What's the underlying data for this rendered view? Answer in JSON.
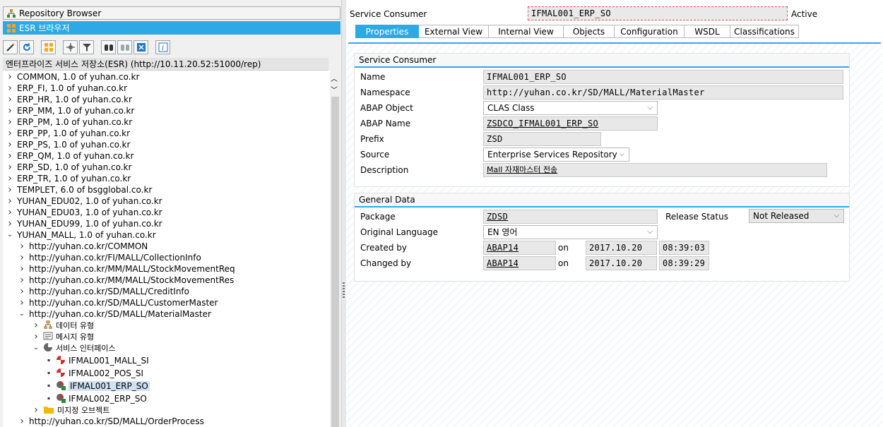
{
  "nav": {
    "repository_browser": "Repository Browser",
    "esr_browser": "ESR 브라우저"
  },
  "toolbar_icons": [
    "wand-icon",
    "refresh-icon",
    "hierarchy-icon",
    "settings-icon",
    "filter-icon",
    "binoculars-icon",
    "binoculars-next-icon",
    "delete-icon",
    "info-icon"
  ],
  "path_label": "엔터프라이즈 서비스 저장소(ESR) (http://10.11.20.52:51000/rep)",
  "tree": [
    {
      "label": "COMMON, 1.0 of yuhan.co.kr",
      "level": 0,
      "chevron": ">",
      "icon": ""
    },
    {
      "label": "ERP_FI, 1.0 of yuhan.co.kr",
      "level": 0,
      "chevron": ">",
      "icon": ""
    },
    {
      "label": "ERP_HR, 1.0 of yuhan.co.kr",
      "level": 0,
      "chevron": ">",
      "icon": ""
    },
    {
      "label": "ERP_MM, 1.0 of yuhan.co.kr",
      "level": 0,
      "chevron": ">",
      "icon": ""
    },
    {
      "label": "ERP_PM, 1.0 of yuhan.co.kr",
      "level": 0,
      "chevron": ">",
      "icon": ""
    },
    {
      "label": "ERP_PP, 1.0 of yuhan.co.kr",
      "level": 0,
      "chevron": ">",
      "icon": ""
    },
    {
      "label": "ERP_PS, 1.0 of yuhan.co.kr",
      "level": 0,
      "chevron": ">",
      "icon": ""
    },
    {
      "label": "ERP_QM, 1.0 of yuhan.co.kr",
      "level": 0,
      "chevron": ">",
      "icon": ""
    },
    {
      "label": "ERP_SD, 1.0 of yuhan.co.kr",
      "level": 0,
      "chevron": ">",
      "icon": ""
    },
    {
      "label": "ERP_TR, 1.0 of yuhan.co.kr",
      "level": 0,
      "chevron": ">",
      "icon": ""
    },
    {
      "label": "TEMPLET, 6.0 of bsgglobal.co.kr",
      "level": 0,
      "chevron": ">",
      "icon": ""
    },
    {
      "label": "YUHAN_EDU02, 1.0 of yuhan.co.kr",
      "level": 0,
      "chevron": ">",
      "icon": ""
    },
    {
      "label": "YUHAN_EDU03, 1.0 of yuhan.co.kr",
      "level": 0,
      "chevron": ">",
      "icon": ""
    },
    {
      "label": "YUHAN_EDU99, 1.0 of yuhan.co.kr",
      "level": 0,
      "chevron": ">",
      "icon": ""
    },
    {
      "label": "YUHAN_MALL, 1.0 of yuhan.co.kr",
      "level": 0,
      "chevron": "v",
      "icon": ""
    },
    {
      "label": "http://yuhan.co.kr/COMMON",
      "level": 1,
      "chevron": ">",
      "icon": ""
    },
    {
      "label": "http://yuhan.co.kr/FI/MALL/CollectionInfo",
      "level": 1,
      "chevron": ">",
      "icon": ""
    },
    {
      "label": "http://yuhan.co.kr/MM/MALL/StockMovementReq",
      "level": 1,
      "chevron": ">",
      "icon": ""
    },
    {
      "label": "http://yuhan.co.kr/MM/MALL/StockMovementRes",
      "level": 1,
      "chevron": ">",
      "icon": ""
    },
    {
      "label": "http://yuhan.co.kr/SD/MALL/CreditInfo",
      "level": 1,
      "chevron": ">",
      "icon": ""
    },
    {
      "label": "http://yuhan.co.kr/SD/MALL/CustomerMaster",
      "level": 1,
      "chevron": ">",
      "icon": ""
    },
    {
      "label": "http://yuhan.co.kr/SD/MALL/MaterialMaster",
      "level": 1,
      "chevron": "v",
      "icon": ""
    },
    {
      "label": "데이터 유형",
      "level": 2,
      "chevron": ">",
      "icon": "datatype-icon"
    },
    {
      "label": "메시지 유형",
      "level": 2,
      "chevron": ">",
      "icon": "message-type-icon"
    },
    {
      "label": "서비스 인터페이스",
      "level": 2,
      "chevron": "v",
      "icon": "service-interface-icon"
    },
    {
      "label": "IFMAL001_MALL_SI",
      "level": 3,
      "chevron": "•",
      "icon": "interface-icon"
    },
    {
      "label": "IFMAL002_POS_SI",
      "level": 3,
      "chevron": "•",
      "icon": "interface-icon"
    },
    {
      "label": "IFMAL001_ERP_SO",
      "level": 3,
      "chevron": "•",
      "icon": "consumer-icon",
      "selected": true
    },
    {
      "label": "IFMAL002_ERP_SO",
      "level": 3,
      "chevron": "•",
      "icon": "consumer-icon"
    },
    {
      "label": "미지정 오브젝트",
      "level": 2,
      "chevron": ">",
      "icon": "folder-icon"
    },
    {
      "label": "http://yuhan.co.kr/SD/MALL/OrderProcess",
      "level": 1,
      "chevron": ">",
      "icon": ""
    }
  ],
  "header": {
    "object_type": "Service Consumer",
    "object_name": "IFMAL001_ERP_SO",
    "status": "Active"
  },
  "tabs": [
    "Properties",
    "External View",
    "Internal View",
    "Objects",
    "Configuration",
    "WSDL",
    "Classifications"
  ],
  "active_tab": "Properties",
  "service_consumer_group": {
    "title": "Service Consumer",
    "name_label": "Name",
    "name_value": "IFMAL001_ERP_SO",
    "namespace_label": "Namespace",
    "namespace_value": "http://yuhan.co.kr/SD/MALL/MaterialMaster",
    "abap_object_label": "ABAP Object",
    "abap_object_value": "CLAS Class",
    "abap_name_label": "ABAP Name",
    "abap_name_value": "ZSDCO_IFMAL001_ERP_SO",
    "prefix_label": "Prefix",
    "prefix_value": "ZSD",
    "source_label": "Source",
    "source_value": "Enterprise Services Repository",
    "description_label": "Description",
    "description_value": "Mall 자재마스터 전송"
  },
  "general_data_group": {
    "title": "General Data",
    "package_label": "Package",
    "package_value": "ZDSD",
    "release_status_label": "Release Status",
    "release_status_value": "Not Released",
    "original_language_label": "Original Language",
    "original_language_value": "EN 영어",
    "created_by_label": "Created by",
    "created_by_value": "ABAP14",
    "created_on_label": "on",
    "created_date": "2017.10.20",
    "created_time": "08:39:03",
    "changed_by_label": "Changed by",
    "changed_by_value": "ABAP14",
    "changed_on_label": "on",
    "changed_date": "2017.10.20",
    "changed_time": "08:39:29"
  },
  "colors": {
    "accent": "#2ea9e5",
    "field_bg": "#e8e8e8",
    "selection": "#cfe1f2"
  }
}
